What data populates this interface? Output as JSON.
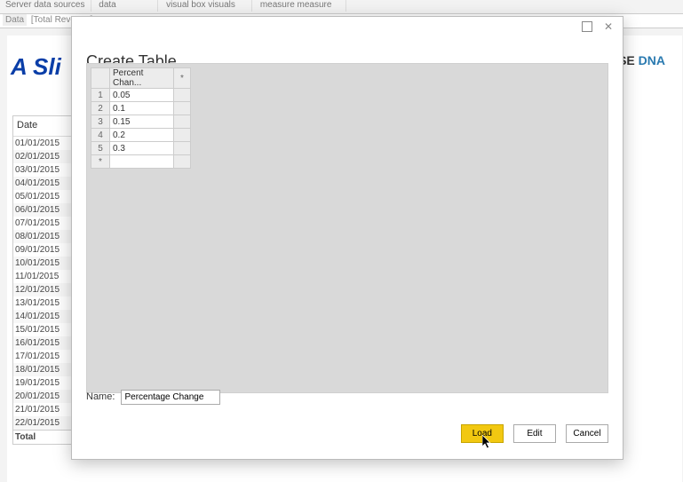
{
  "ribbon": {
    "group1": "Server   data   sources",
    "group2": "data",
    "group3": "visual   box   visuals",
    "group4": "measure  measure"
  },
  "formula": {
    "label": "Data",
    "text": "[Total Revenue]"
  },
  "brand": {
    "left": "A Sli",
    "right1": "RISE ",
    "right2": "DNA"
  },
  "datePanel": {
    "header": "Date",
    "rows": [
      "01/01/2015",
      "02/01/2015",
      "03/01/2015",
      "04/01/2015",
      "05/01/2015",
      "06/01/2015",
      "07/01/2015",
      "08/01/2015",
      "09/01/2015",
      "10/01/2015",
      "11/01/2015",
      "12/01/2015",
      "13/01/2015",
      "14/01/2015",
      "15/01/2015",
      "16/01/2015",
      "17/01/2015",
      "18/01/2015",
      "19/01/2015",
      "20/01/2015",
      "21/01/2015",
      "22/01/2015"
    ],
    "total": "Total"
  },
  "dialog": {
    "title": "Create Table",
    "colHeader": "Percent Chan...",
    "extraHeader": "*",
    "rows": [
      {
        "n": "1",
        "v": "0.05"
      },
      {
        "n": "2",
        "v": "0.1"
      },
      {
        "n": "3",
        "v": "0.15"
      },
      {
        "n": "4",
        "v": "0.2"
      },
      {
        "n": "5",
        "v": "0.3"
      }
    ],
    "newRow": "*",
    "nameLabel": "Name:",
    "nameValue": "Percentage Change",
    "load": "Load",
    "edit": "Edit",
    "cancel": "Cancel"
  }
}
